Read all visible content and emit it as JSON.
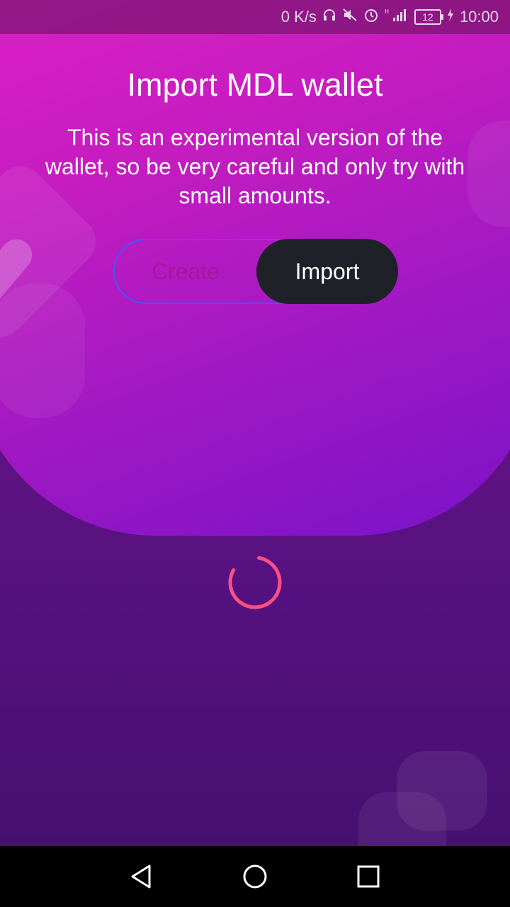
{
  "status_bar": {
    "network_speed": "0 K/s",
    "battery_level": "12",
    "time": "10:00",
    "icons": [
      "headphones-icon",
      "mute-icon",
      "alarm-icon",
      "signal-icon",
      "battery-icon",
      "charging-icon"
    ]
  },
  "page": {
    "title": "Import MDL wallet",
    "description": "This is an experimental version of the wallet, so be very careful and only try with small amounts."
  },
  "toggle": {
    "create_label": "Create",
    "import_label": "Import",
    "selected": "Import"
  },
  "colors": {
    "accent": "#3a5cff",
    "selected_bg": "#1f2128",
    "spinner": "#ff4f86",
    "create_text": "#a8169f"
  },
  "navbar": {
    "icons": [
      "back-icon",
      "home-icon",
      "recents-icon"
    ]
  }
}
